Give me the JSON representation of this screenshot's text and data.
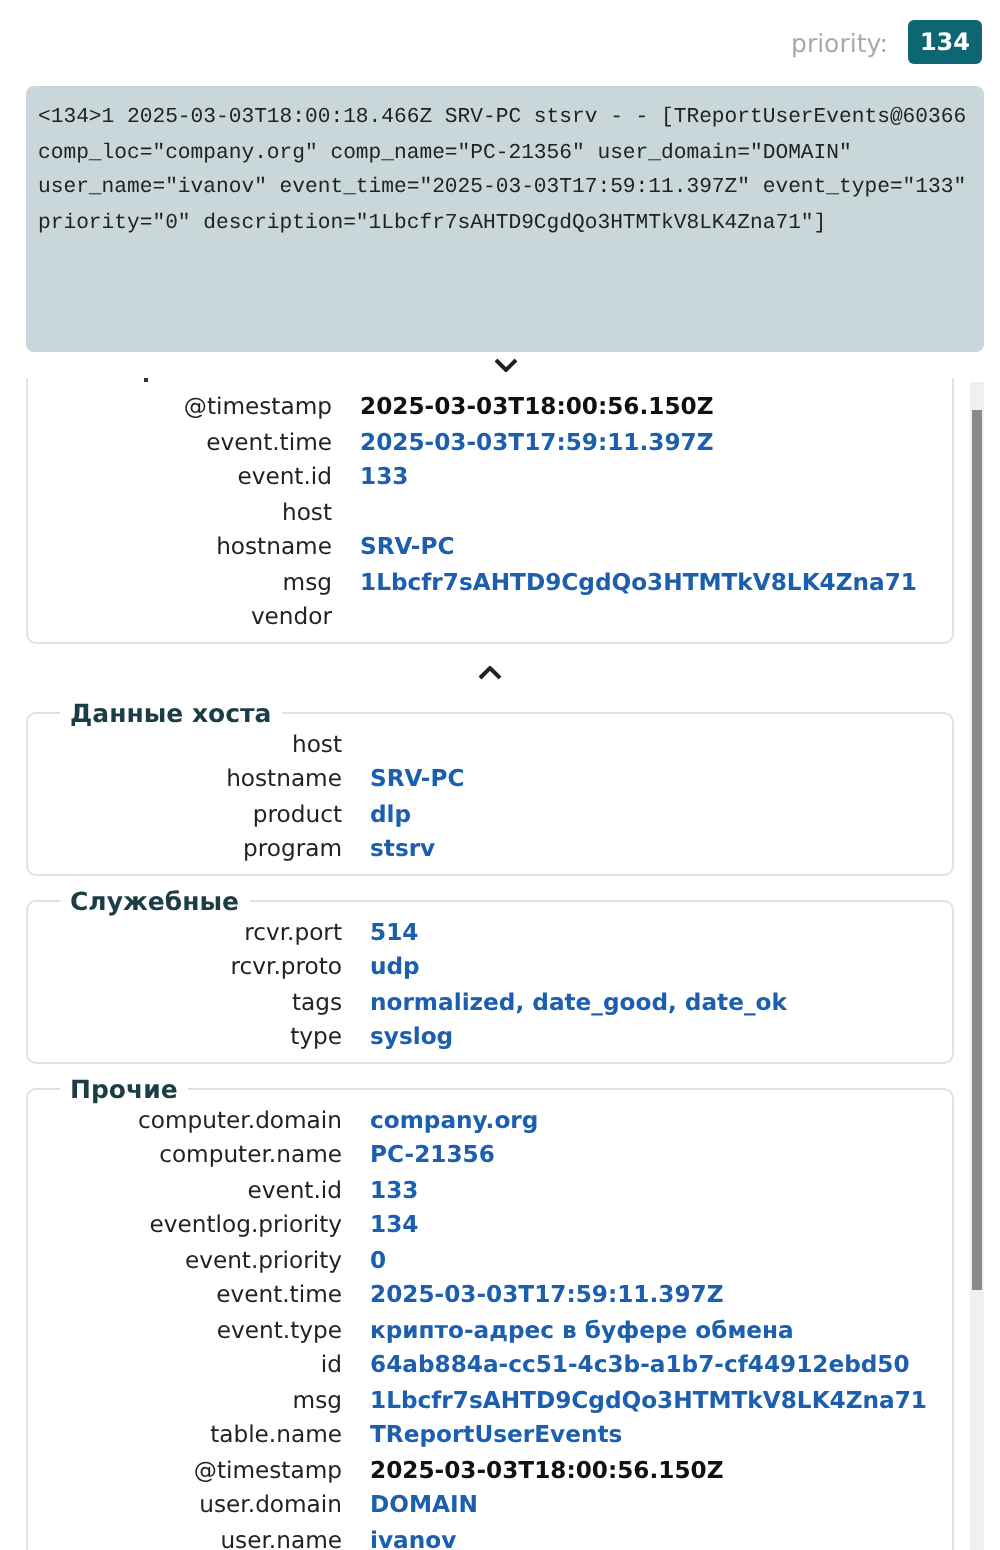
{
  "priority": {
    "label": "priority:",
    "value": "134"
  },
  "raw_log": "<134>1 2025-03-03T18:00:18.466Z SRV-PC stsrv - - [TReportUserEvents@60366 comp_loc=\"company.org\" comp_name=\"PC-21356\" user_domain=\"DOMAIN\" user_name=\"ivanov\" event_time=\"2025-03-03T17:59:11.397Z\" event_type=\"133\" priority=\"0\" description=\"1Lbcfr7sAHTD9CgdQo3HTMTkV8LK4Zna71\"]",
  "collapse_expanded": false,
  "summary": {
    "fields": [
      {
        "label": "@timestamp",
        "value": "2025-03-03T18:00:56.150Z",
        "kind": "plain"
      },
      {
        "label": "event.time",
        "value": "2025-03-03T17:59:11.397Z",
        "kind": "link"
      },
      {
        "label": "event.id",
        "value": "133",
        "kind": "link"
      },
      {
        "label": "host"
      },
      {
        "label": "hostname",
        "value": "SRV-PC",
        "kind": "link"
      },
      {
        "label": "msg",
        "value": "1Lbcfr7sAHTD9CgdQo3HTMTkV8LK4Zna71",
        "kind": "link"
      },
      {
        "label": "vendor"
      }
    ]
  },
  "sections": [
    {
      "title": "Данные хоста",
      "fields": [
        {
          "label": "host"
        },
        {
          "label": "hostname",
          "value": "SRV-PC",
          "kind": "link"
        },
        {
          "label": "product",
          "value": "dlp",
          "kind": "link"
        },
        {
          "label": "program",
          "value": "stsrv",
          "kind": "link"
        }
      ]
    },
    {
      "title": "Служебные",
      "fields": [
        {
          "label": "rcvr.port",
          "value": "514",
          "kind": "link"
        },
        {
          "label": "rcvr.proto",
          "value": "udp",
          "kind": "link"
        },
        {
          "label": "tags",
          "value": "normalized, date_good, date_ok",
          "kind": "link"
        },
        {
          "label": "type",
          "value": "syslog",
          "kind": "link"
        }
      ]
    },
    {
      "title": "Прочие",
      "fields": [
        {
          "label": "computer.domain",
          "value": "company.org",
          "kind": "link"
        },
        {
          "label": "computer.name",
          "value": "PC-21356",
          "kind": "link"
        },
        {
          "label": "event.id",
          "value": "133",
          "kind": "link"
        },
        {
          "label": "eventlog.priority",
          "value": "134",
          "kind": "link"
        },
        {
          "label": "event.priority",
          "value": "0",
          "kind": "link"
        },
        {
          "label": "event.time",
          "value": "2025-03-03T17:59:11.397Z",
          "kind": "link"
        },
        {
          "label": "event.type",
          "value": "крипто-адрес в буфере обмена",
          "kind": "link"
        },
        {
          "label": "id",
          "value": "64ab884a-cc51-4c3b-a1b7-cf44912ebd50",
          "kind": "link"
        },
        {
          "label": "msg",
          "value": "1Lbcfr7sAHTD9CgdQo3HTMTkV8LK4Zna71",
          "kind": "link"
        },
        {
          "label": "table.name",
          "value": "TReportUserEvents",
          "kind": "link"
        },
        {
          "label": "@timestamp",
          "value": "2025-03-03T18:00:56.150Z",
          "kind": "plain"
        },
        {
          "label": "user.domain",
          "value": "DOMAIN",
          "kind": "link"
        },
        {
          "label": "user.name",
          "value": "ivanov",
          "kind": "link"
        }
      ]
    }
  ]
}
